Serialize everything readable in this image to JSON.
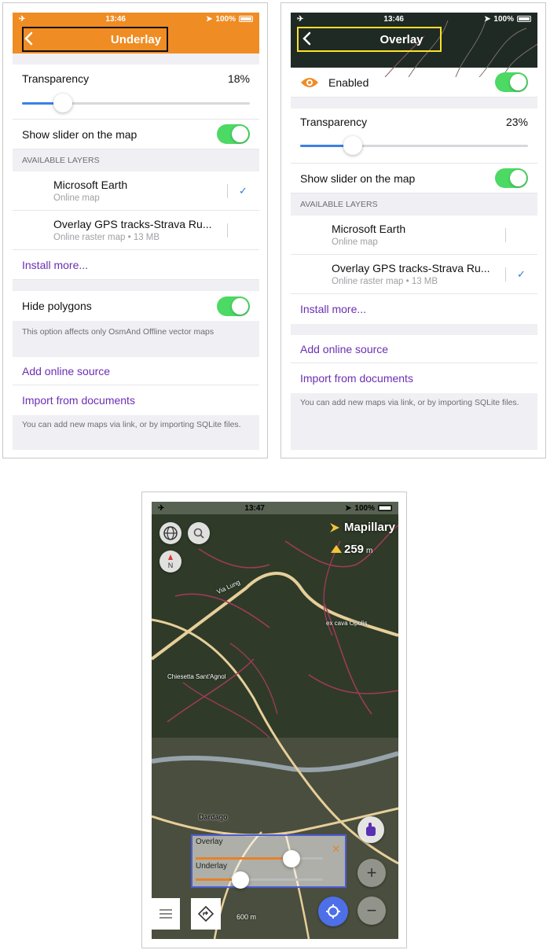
{
  "colors": {
    "orange": "#f08c24",
    "toggle_green": "#4cd964",
    "link_purple": "#6b2fb3",
    "slider_blue": "#3b82e4",
    "highlight_black": "#111111",
    "highlight_yellow": "#ffe02a",
    "panel_blue": "#4d5bd6"
  },
  "underlay_screen": {
    "status": {
      "time": "13:46",
      "battery": "100%"
    },
    "title": "Underlay",
    "transparency": {
      "label": "Transparency",
      "value": "18%",
      "fraction": 0.18
    },
    "show_slider_label": "Show slider on the map",
    "available_layers_header": "AVAILABLE LAYERS",
    "layers": [
      {
        "title": "Microsoft Earth",
        "subtitle": "Online map",
        "selected": true
      },
      {
        "title": "Overlay GPS tracks-Strava Ru...",
        "subtitle": "Online raster map • 13 MB",
        "selected": false
      }
    ],
    "install_more": "Install more...",
    "hide_polygons_label": "Hide polygons",
    "hide_polygons_note": "This option affects only OsmAnd Offline vector maps",
    "add_online_source": "Add online source",
    "import_from_documents": "Import from documents",
    "footer_note": "You can add new maps via link, or by importing SQLite files."
  },
  "overlay_screen": {
    "status": {
      "time": "13:46",
      "battery": "100%"
    },
    "title": "Overlay",
    "enabled_label": "Enabled",
    "transparency": {
      "label": "Transparency",
      "value": "23%",
      "fraction": 0.23
    },
    "show_slider_label": "Show slider on the map",
    "available_layers_header": "AVAILABLE LAYERS",
    "layers": [
      {
        "title": "Microsoft Earth",
        "subtitle": "Online map",
        "selected": false
      },
      {
        "title": "Overlay GPS tracks-Strava Ru...",
        "subtitle": "Online raster map • 13 MB",
        "selected": true
      }
    ],
    "install_more": "Install more...",
    "add_online_source": "Add online source",
    "import_from_documents": "Import from documents",
    "footer_note": "You can add new maps via link, or by importing SQLite files."
  },
  "map_screen": {
    "status": {
      "time": "13:47",
      "battery": "100%"
    },
    "mapillary_label": "Mapillary",
    "altitude_value": "259",
    "altitude_unit": "m",
    "place_labels": [
      "ex cava Opolis",
      "Chiesetta Sant'Agnol",
      "Dardago",
      "Via Lung"
    ],
    "overlay_label": "Overlay",
    "underlay_label": "Underlay",
    "overlay_level": 0.75,
    "underlay_level": 0.35,
    "scale_label": "600 m",
    "icons": [
      "globe-icon",
      "search-icon",
      "compass-icon",
      "hand-pointer-icon",
      "zoom-in-icon",
      "zoom-out-icon",
      "menu-icon",
      "route-icon",
      "my-location-icon",
      "close-icon"
    ]
  }
}
